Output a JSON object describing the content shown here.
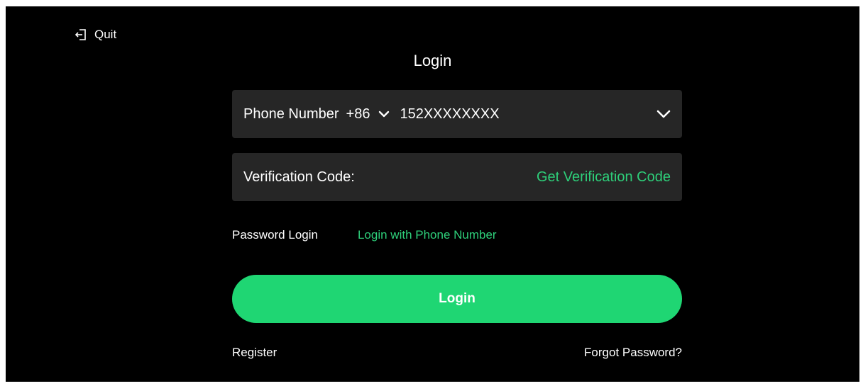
{
  "header": {
    "quit_label": "Quit",
    "title": "Login"
  },
  "phone": {
    "label": "Phone Number",
    "country_code": "+86",
    "value": "152XXXXXXXX"
  },
  "code": {
    "label": "Verification Code:",
    "get_code_label": "Get Verification Code"
  },
  "login_modes": {
    "password": "Password Login",
    "phone": "Login with Phone Number"
  },
  "login_button": "Login",
  "footer": {
    "register": "Register",
    "forgot": "Forgot Password?"
  },
  "icons": {
    "quit": "logout-icon",
    "country_dropdown": "chevron-down-icon",
    "phone_dropdown": "chevron-down-icon"
  },
  "colors": {
    "accent": "#1fd673",
    "link": "#2ecf7a",
    "background": "#000000",
    "field": "#262626"
  }
}
